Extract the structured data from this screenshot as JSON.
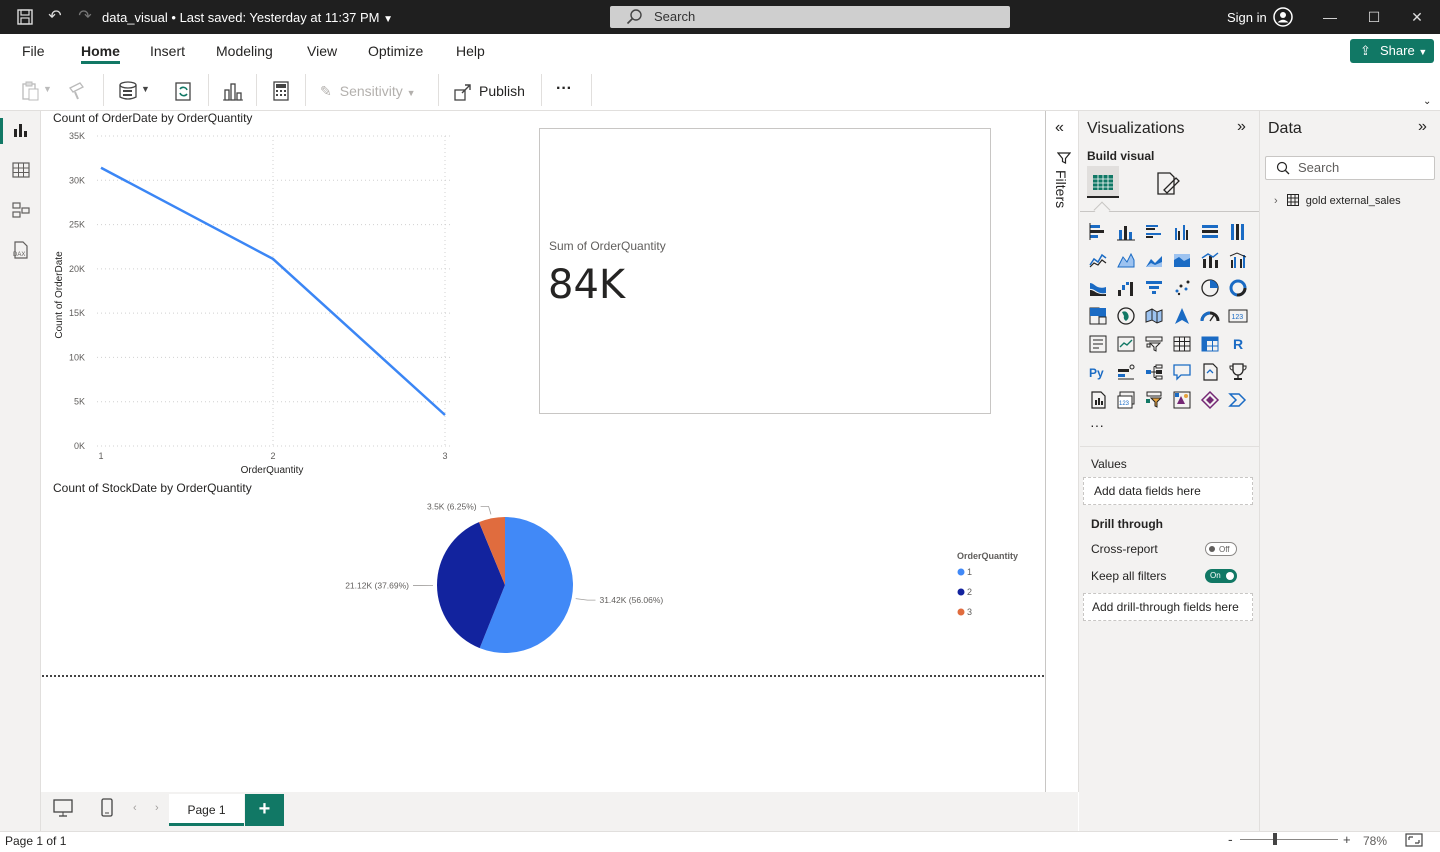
{
  "title_bar": {
    "file_name": "data_visual",
    "save_status": "• Last saved: Yesterday at 11:37 PM",
    "search_placeholder": "Search",
    "signin": "Sign in"
  },
  "menu": {
    "items": [
      "File",
      "Home",
      "Insert",
      "Modeling",
      "View",
      "Optimize",
      "Help"
    ],
    "active": "Home",
    "share_label": "Share"
  },
  "ribbon": {
    "sensitivity_label": "Sensitivity",
    "publish_label": "Publish",
    "more_label": "···"
  },
  "canvas": {
    "line_chart_title": "Count of OrderDate by OrderQuantity",
    "pie_chart_title": "Count of StockDate by OrderQuantity",
    "card": {
      "label": "Sum of OrderQuantity",
      "value": "84K"
    }
  },
  "chart_data": [
    {
      "type": "line",
      "title": "Count of OrderDate by OrderQuantity",
      "xlabel": "OrderQuantity",
      "ylabel": "Count of OrderDate",
      "x": [
        1,
        2,
        3
      ],
      "series": [
        {
          "values": [
            31420,
            21120,
            3500
          ]
        }
      ],
      "ylim": [
        0,
        35000
      ],
      "yticks": [
        "0K",
        "5K",
        "10K",
        "15K",
        "20K",
        "25K",
        "30K",
        "35K"
      ],
      "xticks": [
        "1",
        "2",
        "3"
      ],
      "color": "#3b86f5",
      "grid": true
    },
    {
      "type": "pie",
      "title": "Count of StockDate by OrderQuantity",
      "legend_title": "OrderQuantity",
      "legend_position": "right",
      "slices": [
        {
          "label": "1",
          "value": 31420,
          "text": "31.42K (56.06%)",
          "color": "#4189f7"
        },
        {
          "label": "2",
          "value": 21120,
          "text": "21.12K (37.69%)",
          "color": "#12239e"
        },
        {
          "label": "3",
          "value": 3500,
          "text": "3.5K (6.25%)",
          "color": "#e06c3e"
        }
      ]
    }
  ],
  "pages": {
    "tabs": [
      "Page 1"
    ],
    "active": "Page 1",
    "status": "Page 1 of 1",
    "zoom": "78%"
  },
  "filters_label": "Filters",
  "visualizations": {
    "title": "Visualizations",
    "build_visual": "Build visual",
    "values_label": "Values",
    "values_placeholder": "Add data fields here",
    "drill_through": "Drill through",
    "cross_report": "Cross-report",
    "cross_report_state": "Off",
    "keep_filters": "Keep all filters",
    "keep_filters_state": "On",
    "drill_placeholder": "Add drill-through fields here",
    "more": "···"
  },
  "data_pane": {
    "title": "Data",
    "search_placeholder": "Search",
    "tables": [
      "gold external_sales"
    ]
  },
  "colors": {
    "accent": "#117865",
    "titlebar": "#1f1f1f"
  }
}
